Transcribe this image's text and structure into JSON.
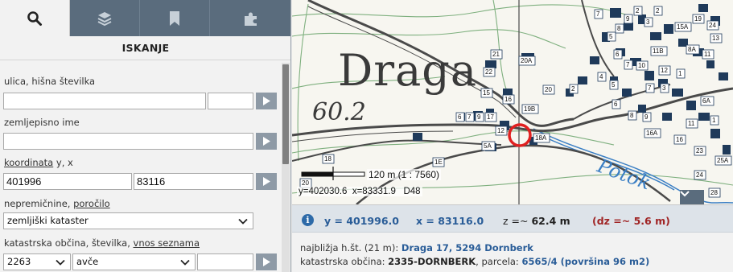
{
  "tabs": [
    {
      "name": "search",
      "icon": "search-icon",
      "active": true
    },
    {
      "name": "layers",
      "icon": "layers-icon",
      "active": false
    },
    {
      "name": "bookmark",
      "icon": "bookmark-icon",
      "active": false
    },
    {
      "name": "tools",
      "icon": "puzzle-icon",
      "active": false
    }
  ],
  "panel": {
    "title": "ISKANJE",
    "street": {
      "label": "ulica, hišna številka",
      "value": "",
      "number_value": ""
    },
    "place": {
      "label": "zemljepisno ime",
      "value": ""
    },
    "coords": {
      "label_link": "koordinata",
      "label_rest": " y, x",
      "y_value": "401996",
      "x_value": "83116"
    },
    "property": {
      "label_plain": "nepremičnine, ",
      "label_link": "poročilo",
      "selected": "zemljiški kataster"
    },
    "cadastral": {
      "label_plain": "katastrska občina, številka, ",
      "label_link": "vnos seznama",
      "code_selected": "2263",
      "name_value": "avče",
      "number_value": ""
    }
  },
  "map": {
    "place_label": "Draga",
    "elevation_label": "60.2",
    "scale_text": "120 m  (1 : 7560)",
    "coord_readout": "y=402030.6  x=83331.9   D48",
    "house_labels": [
      "21",
      "20A",
      "22",
      "20",
      "15",
      "16",
      "19B",
      "6",
      "7",
      "9",
      "17",
      "12",
      "18A",
      "5A",
      "1E",
      "18",
      "20",
      "2",
      "3",
      "4",
      "5",
      "6",
      "7",
      "8",
      "9",
      "10",
      "11",
      "15A",
      "16A",
      "19",
      "13",
      "24",
      "28",
      "12",
      "23",
      "25A",
      "6A",
      "8A",
      "11B",
      "1"
    ],
    "accent_marker_color": "#e02020"
  },
  "info": {
    "y_text": "y = 401996.0",
    "x_text": "x = 83116.0",
    "z_prefix": "z =~ ",
    "z_value": "62.4 m",
    "dz_text": "(dz =~ 5.6 m)",
    "nearest_prefix": "najbližja h.št. (21 m): ",
    "nearest_link": "Draga 17, 5294 Dornberk",
    "cadastre_prefix": "katastrska občina: ",
    "cadastre_name": "2335-DORNBERK",
    "parcel_prefix": ", parcela: ",
    "parcel_link": "6565/4 (površina 96 m2)"
  },
  "colors": {
    "tabbar": "#5a6c7d",
    "link": "#2a5d98",
    "dz": "#a02525",
    "go_button": "#8e9aa6"
  }
}
